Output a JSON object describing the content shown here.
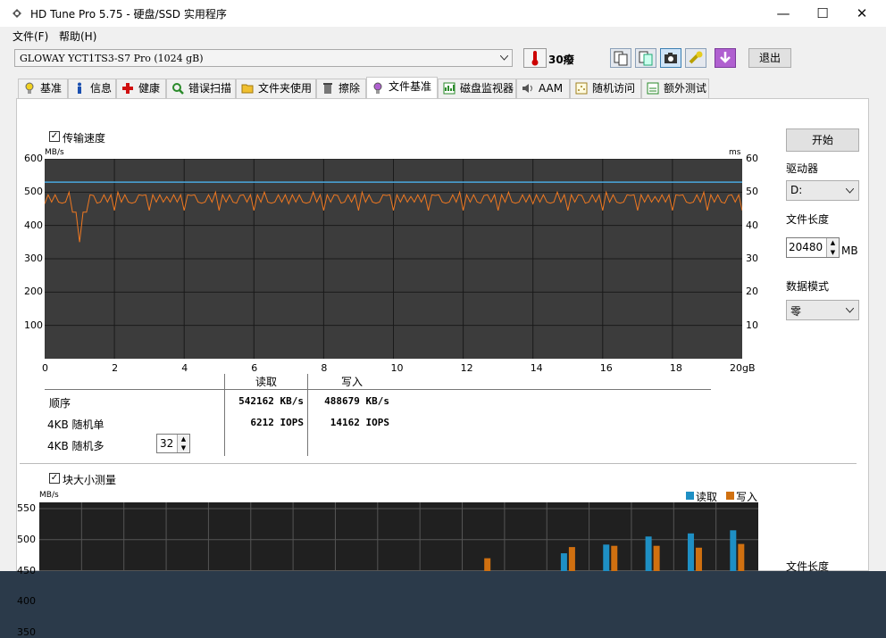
{
  "title": "HD Tune Pro 5.75 - 硬盘/SSD 实用程序",
  "window_buttons": {
    "minimize": "—",
    "maximize": "☐",
    "close": "✕"
  },
  "menu": [
    "文件(F)",
    "帮助(H)"
  ],
  "drive": "GLOWAY YCT1TS3-S7 Pro (1024 gB)",
  "temperature": "30癈",
  "exit_label": "退出",
  "tabs": [
    {
      "label": "基准",
      "icon": "benchmark-icon"
    },
    {
      "label": "信息",
      "icon": "info-icon"
    },
    {
      "label": "健康",
      "icon": "health-icon"
    },
    {
      "label": "错误扫描",
      "icon": "error-scan-icon"
    },
    {
      "label": "文件夹使用",
      "icon": "folder-icon"
    },
    {
      "label": "擦除",
      "icon": "erase-icon"
    },
    {
      "label": "文件基准",
      "icon": "file-benchmark-icon"
    },
    {
      "label": "磁盘监视器",
      "icon": "disk-monitor-icon"
    },
    {
      "label": "AAM",
      "icon": "aam-icon"
    },
    {
      "label": "随机访问",
      "icon": "random-access-icon"
    },
    {
      "label": "额外测试",
      "icon": "extra-tests-icon"
    }
  ],
  "active_tab": "文件基准",
  "transfer": {
    "checkbox_label": "传输速度",
    "checked": true,
    "left_unit": "MB/s",
    "right_unit": "ms",
    "x_unit_suffix": "gB"
  },
  "results": {
    "col_read": "读取",
    "col_write": "写入",
    "rows": [
      {
        "label": "顺序",
        "read": "542162 KB/s",
        "write": "488679 KB/s"
      },
      {
        "label": "4KB 随机单",
        "read": "6212 IOPS",
        "write": "14162 IOPS"
      },
      {
        "label": "4KB 随机多",
        "read": "",
        "write": ""
      }
    ],
    "queue_depth": "32"
  },
  "sidebar": {
    "start_label": "开始",
    "drive_label": "驱动器",
    "drive_value": "D:",
    "file_length_label": "文件长度",
    "file_length_value": "20480",
    "file_length_unit": "MB",
    "data_mode_label": "数据模式",
    "data_mode_value": "零",
    "file_length_label2": "文件长度"
  },
  "block": {
    "checkbox_label": "块大小测量",
    "checked": true,
    "unit": "MB/s",
    "legend_read": "读取",
    "legend_write": "写入"
  },
  "colors": {
    "read_series": "#1e8fc4",
    "write_series": "#d07010",
    "transfer_read_line": "#f07820",
    "access_line": "#4aa8e0",
    "chart_bg": "#3c3c3c"
  },
  "chart_data": [
    {
      "type": "line",
      "title": "",
      "xlabel": "gB",
      "ylabel": "MB/s",
      "y2label": "ms",
      "xlim": [
        0,
        20
      ],
      "ylim": [
        0,
        600
      ],
      "y2lim": [
        0,
        60
      ],
      "x_ticks": [
        "0",
        "2",
        "4",
        "6",
        "8",
        "10",
        "12",
        "14",
        "16",
        "18",
        "20gB"
      ],
      "y_ticks": [
        "100",
        "200",
        "300",
        "400",
        "500",
        "600"
      ],
      "y2_ticks": [
        "10",
        "20",
        "30",
        "40",
        "50",
        "60"
      ],
      "series": [
        {
          "name": "读取",
          "style": "line",
          "approx_level": 480,
          "range": [
            450,
            500
          ],
          "dip": {
            "x": 1.0,
            "value": 350
          }
        },
        {
          "name": "access",
          "style": "line",
          "value_ms": 53
        }
      ]
    },
    {
      "type": "bar",
      "title": "",
      "ylabel": "MB/s",
      "y_ticks": [
        "550",
        "500",
        "450",
        "400",
        "350"
      ],
      "ylim": [
        330,
        560
      ],
      "series": [
        {
          "name": "读取",
          "values": [
            null,
            null,
            null,
            null,
            null,
            null,
            null,
            null,
            200,
            348,
            372,
            442,
            478,
            492,
            505,
            510,
            515
          ]
        },
        {
          "name": "写入",
          "values": [
            null,
            null,
            null,
            null,
            null,
            null,
            null,
            334,
            398,
            447,
            470,
            408,
            488,
            490,
            490,
            487,
            493
          ]
        }
      ]
    }
  ]
}
